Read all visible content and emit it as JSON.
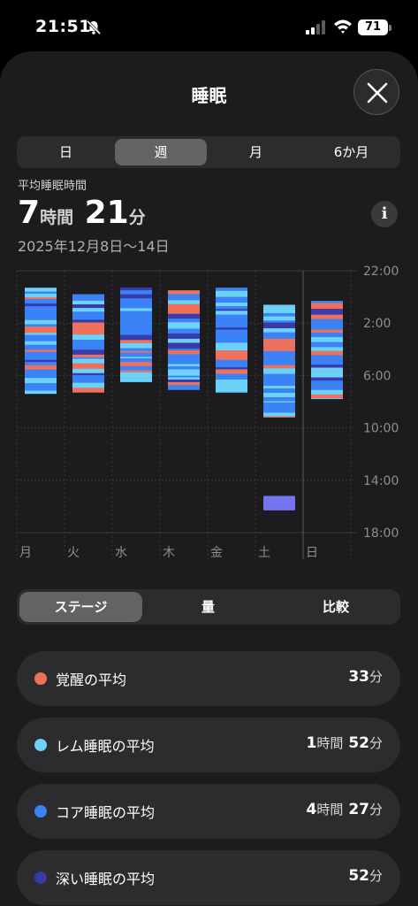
{
  "status_bar": {
    "time": "21:51",
    "battery": "71"
  },
  "header": {
    "title": "睡眠"
  },
  "period_tabs": [
    {
      "label": "日",
      "active": false
    },
    {
      "label": "週",
      "active": true
    },
    {
      "label": "月",
      "active": false
    },
    {
      "label": "6か月",
      "active": false
    }
  ],
  "summary": {
    "label": "平均睡眠時間",
    "hours": "7",
    "hours_unit": "時間",
    "minutes": "21",
    "minutes_unit": "分",
    "date_range": "2025年12月8日〜14日"
  },
  "chart_data": {
    "type": "bar",
    "categories": [
      "月",
      "火",
      "水",
      "木",
      "金",
      "土",
      "日"
    ],
    "y_tick_labels": [
      "22:00",
      "2:00",
      "6:00",
      "10:00",
      "14:00",
      "18:00"
    ],
    "stage_colors": {
      "awake": "#f0705a",
      "rem": "#6cd2f8",
      "core": "#3b82f6",
      "deep": "#3a3aa8"
    },
    "series": [
      {
        "day": "月",
        "start_hour": 23.3,
        "end_hour": 31.4
      },
      {
        "day": "火",
        "start_hour": 23.8,
        "end_hour": 31.3
      },
      {
        "day": "水",
        "start_hour": 23.3,
        "end_hour": 30.5
      },
      {
        "day": "木",
        "start_hour": 23.5,
        "end_hour": 31.1
      },
      {
        "day": "金",
        "start_hour": 23.3,
        "end_hour": 31.3
      },
      {
        "day": "土",
        "start_hour": 24.6,
        "end_hour": 33.2,
        "extra_segment": {
          "start_hour": 39.2,
          "end_hour": 40.3,
          "stage": "deep"
        }
      },
      {
        "day": "日",
        "start_hour": 24.3,
        "end_hour": 31.8
      }
    ]
  },
  "metric_tabs": [
    {
      "label": "ステージ",
      "active": true
    },
    {
      "label": "量",
      "active": false
    },
    {
      "label": "比較",
      "active": false
    }
  ],
  "averages": [
    {
      "label": "覚醒の平均",
      "color": "#f0705a",
      "parts": [
        {
          "n": "33",
          "u": "分"
        }
      ]
    },
    {
      "label": "レム睡眠の平均",
      "color": "#6cd2f8",
      "parts": [
        {
          "n": "1",
          "u": "時間"
        },
        {
          "n": "52",
          "u": "分"
        }
      ]
    },
    {
      "label": "コア睡眠の平均",
      "color": "#3b82f6",
      "parts": [
        {
          "n": "4",
          "u": "時間"
        },
        {
          "n": "27",
          "u": "分"
        }
      ]
    },
    {
      "label": "深い睡眠の平均",
      "color": "#3a3aa8",
      "parts": [
        {
          "n": "52",
          "u": "分"
        }
      ]
    }
  ]
}
